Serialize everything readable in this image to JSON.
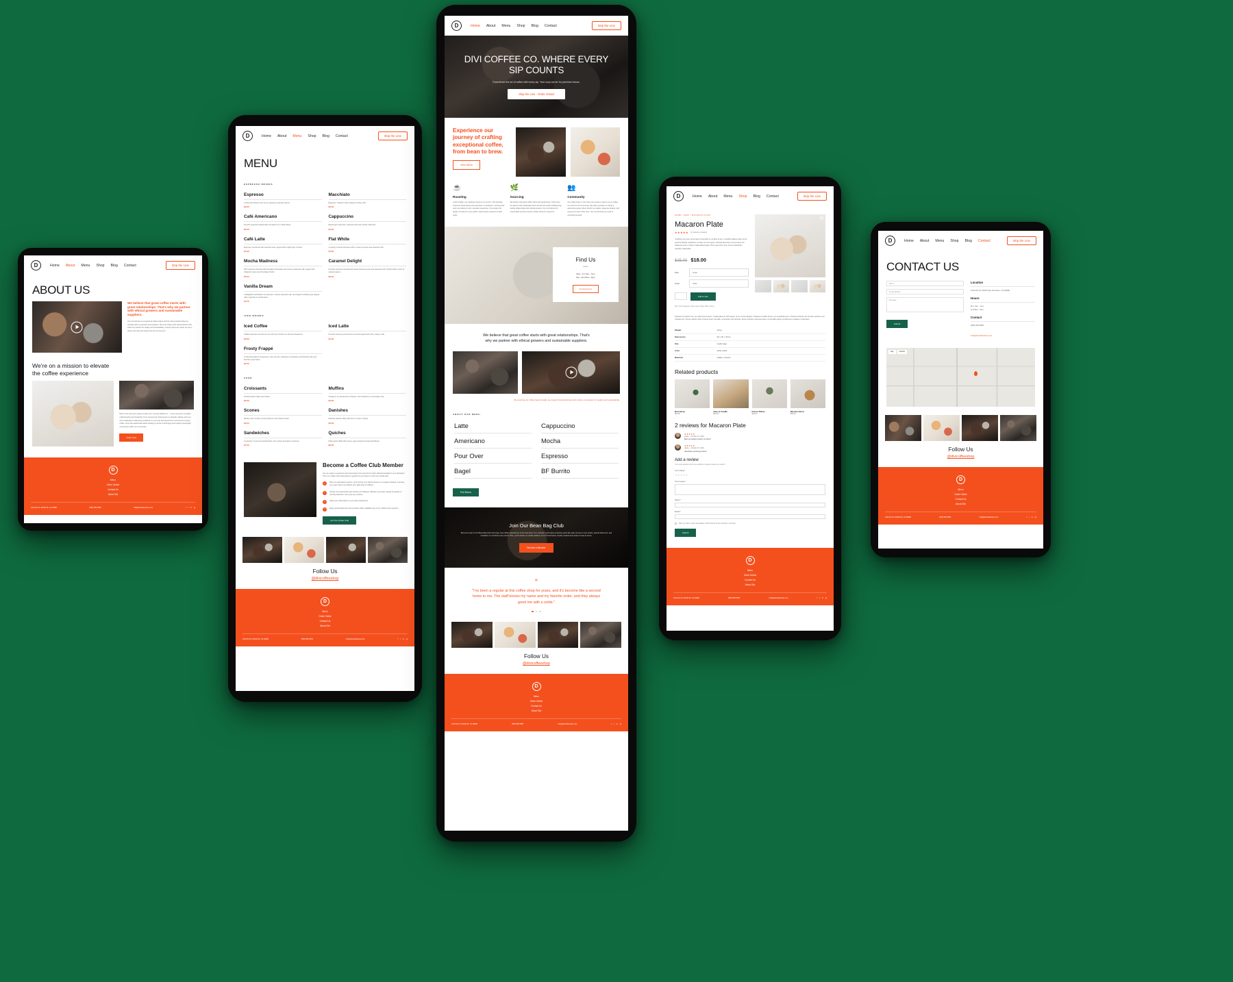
{
  "meta": {
    "background_color": "#0f6b3f",
    "accent": "#f4501e",
    "green": "#17614a"
  },
  "brand": {
    "logo_letter": "D",
    "handle": "@divicoffeeshop",
    "follow_title": "Follow Us"
  },
  "nav": {
    "items": [
      "Home",
      "About",
      "Menu",
      "Shop",
      "Blog",
      "Contact"
    ],
    "cta": "Skip the Line"
  },
  "footer": {
    "links": [
      "Menu",
      "Order Online",
      "Contact Us",
      "About Divi"
    ],
    "address": "1234 Divi St. #1000 SF, CA 94088",
    "phone": "(555) 555-5555",
    "email": "info@divicoffeeshop.com",
    "socials": [
      "f",
      "t",
      "in",
      "ig"
    ]
  },
  "devices": [
    {
      "id": "tablet-about",
      "page": "About Us"
    },
    {
      "id": "phone-menu",
      "page": "Menu"
    },
    {
      "id": "phone-home",
      "page": "Home"
    },
    {
      "id": "phone-product",
      "page": "Macaron Plate"
    },
    {
      "id": "phone-contact",
      "page": "Contact Us"
    }
  ],
  "about_page": {
    "title": "ABOUT US",
    "active_nav": "About",
    "lead": "We believe that great coffee starts with great relationships. That's why we partner with ethical growers and sustainable suppliers.",
    "lead_body": "Our commitment to exceptional coffee begins with the strong relationships we cultivate with our growers and suppliers. We work closely with ethical farmers who share our passion for quality and sustainability, ensuring that every bean we use is grown with care and respect for the environment.",
    "mission_heading": "We're on a mission to elevate the coffee experience",
    "mission_body": "We're more than just a place to grab your morning caffeine fix — we're purveyors of quality, craftsmanship and hospitality. From sourcing the finest beans to carefully crafting each cup, we're dedicated to delivering excellence in every sip. But beyond our commitment to great coffee, we're also passionate about fostering a sense of belonging and creating meaningful connections within our community.",
    "mission_cta": "Order Now"
  },
  "menu_page": {
    "title": "MENU",
    "active_nav": "Menu",
    "categories": [
      {
        "label": "ESPRESSO DRINKS",
        "left": [
          {
            "name": "Espresso",
            "desc": "A bold and intense shot of our signature espresso blend.",
            "price": "$3.00"
          },
          {
            "name": "Café Americano",
            "desc": "Smooth espresso diluted with hot water for a milder flavor.",
            "price": "$3.50"
          },
          {
            "name": "Café Latte",
            "desc": "Espresso combined with steamed milk, topped with a light layer of foam.",
            "price": "$4.50"
          },
          {
            "name": "Mocha Madness",
            "desc": "Rich espresso blended with decadent chocolate and creamy steamed milk, topped with whipped cream and chocolate drizzle.",
            "price": "$5.00"
          },
          {
            "name": "Vanilla Dream",
            "desc": "A delightful combination of espresso, velvety steamed milk, and fragrant vanilla syrup topped with a sprinkle of vanilla bean.",
            "price": "$4.75"
          }
        ],
        "right": [
          {
            "name": "Macchiato",
            "desc": "Espresso \"stained\" with a dollop of frothy milk.",
            "price": "$3.50"
          },
          {
            "name": "Cappuccino",
            "desc": "Equal parts espresso, steamed milk and velvety milk foam.",
            "price": "$4.00"
          },
          {
            "name": "Flat White",
            "desc": "A velvety smooth espresso with a creamy texture and steamed milk.",
            "price": "$4.50"
          },
          {
            "name": "Caramel Delight",
            "desc": "Smooth espresso infused with sweet caramel syrup and steamed milk, finished with a swirl of caramel sauce.",
            "price": "$5.00"
          }
        ]
      },
      {
        "label": "ICED DRINKS",
        "left": [
          {
            "name": "Iced Coffee",
            "desc": "Chilled espresso served over ice with your choice of milk and sweetener.",
            "price": "$3.50"
          },
          {
            "name": "Frosty Frappé",
            "desc": "A refreshing blend of espresso, milk, and ice, whipped to perfection and finished with your favorite syrup flavor.",
            "price": "$5.25"
          }
        ],
        "right": [
          {
            "name": "Iced Latte",
            "desc": "Smooth espresso poured over ice and topped with cold, creamy milk.",
            "price": "$4.25"
          }
        ]
      },
      {
        "label": "FOOD",
        "left": [
          {
            "name": "Croissants",
            "desc": "Freshly baked, flaky and buttery.",
            "price": "$3.00"
          },
          {
            "name": "Scones",
            "desc": "Buttery and crumbly, served with jam and clotted cream.",
            "price": "$3.25"
          },
          {
            "name": "Sandwiches",
            "desc": "A selection of gourmet sandwiches, from turkey avocado to caprese.",
            "price": "$7.50"
          }
        ],
        "right": [
          {
            "name": "Muffins",
            "desc": "Indulge in an assortment of flavors, from blueberry to chocolate chip.",
            "price": "$3.00"
          },
          {
            "name": "Danishes",
            "desc": "Delicate pastries filled with fruit or cream cheese.",
            "price": "$3.50"
          },
          {
            "name": "Quiches",
            "desc": "Flaky pastry filled with savory egg custard and assorted fillings.",
            "price": "$6.50"
          }
        ]
      }
    ],
    "club": {
      "title": "Become a Coffee Club Member",
      "intro": "Are you ready to experience the finest beans from around the world, delivered straight to your doorstep? Then our Coffee Club Subscription is perfect for you! Here's to how you should start:",
      "steps": [
        "Pick our subscription service, you'll receive your favorite beans on a regular schedule, ensuring you never have to go without your daily dose of caffeine.",
        "Choose the subscription plan that fits your lifestyle. Whether you prefer weekly, bi-weekly, or monthly deliveries, we've got you covered.",
        "Tailor your subscription to your taste preferences.",
        "Enjoy special discounts and exclusive offers available only to our Coffee Club members."
      ],
      "cta": "Join the Coffee Club"
    }
  },
  "home_page": {
    "active_nav": "Home",
    "hero_title": "DIVI COFFEE CO. WHERE EVERY SIP COUNTS",
    "hero_sub": "Experience the art of coffee with every sip. Your cozy corner for premium brews.",
    "hero_cta": "Skip the Line - Order Ahead",
    "intro_heading": "Experience our journey of crafting exceptional coffee, from bean to brew.",
    "intro_cta": "View Menu",
    "features": [
      {
        "icon": "☕",
        "title": "Roasting",
        "body": "At Divi Coffee, our roasting process is an art form. We carefully select the finest beans and roast them to perfection, ensuring that each cup delivers a rich, aromatic experience. Our passion for quality is evident in every batch, capturing the essence of each origin."
      },
      {
        "icon": "🌿",
        "title": "Sourcing",
        "body": "We believe that great coffee starts with great beans. That's why we partner with sustainable farms around the world, building long-lasting relationships with ethical growers. Our commitment to responsible sourcing means a better future for everyone."
      },
      {
        "icon": "👥",
        "title": "Community",
        "body": "Our coffee shop is more than just a place to grab a cup of coffee, it's a hub for the community. We pride ourselves on being a welcoming space where friends can gather, ideas are shared, and everyone is part of the story. Join us and become a part of something special."
      }
    ],
    "find_us": {
      "title": "Find Us",
      "subtitle": "Hours",
      "address_line1": "Mon - Fri   7am - 7pm",
      "address_line2": "Sat - Sun   8am - 5pm",
      "cta": "Get Directions"
    },
    "relationships_text": "We believe that great coffee starts with great relationships. That's why we partner with ethical growers and sustainable suppliers.",
    "sourcing_note": "By sourcing our coffee beans locally, we support trusted farmers who share our passion for quality and sustainability.",
    "about_tag": "ABOUT OUR MENU",
    "wordlist_left": [
      "Latte",
      "Americano",
      "Pour Over",
      "Bagel"
    ],
    "wordlist_right": [
      "Cappuccino",
      "Mocha",
      "Espresso",
      "BF Burrito"
    ],
    "wordlist_cta": "Full Menu",
    "band": {
      "title": "Join Our Bean Bag Club",
      "body": "Become a part of our Bean Bag Club and enjoy new coffee experiences to the next level. As a member you'll enjoy exclusive perks like early access to new roasts, special discounts, and invitations to members-only events. Plus, you'll receive a monthly delivery of our finest beans, freshly roasted and ready to brew at home.",
      "cta": "Become a Member"
    },
    "testimonial": {
      "text": "\"I've been a regular at this coffee shop for years, and it's become like a second home to me. The staff knows my name and my favorite order, and they always greet me with a smile.\""
    }
  },
  "product_page": {
    "active_nav": "Shop",
    "breadcrumb": "HOME / SHOP / MACARON PLATE",
    "title": "Macaron Plate",
    "rating_count": "(2 customer reviews)",
    "description": "Curabitur arcu erat, accumsan id imperdiet et, porttitor at sem. Curabitur aliquet quam id dui posuere blandit. Vestibulum ac diam sit amet quam vehicula elementum sed sit amet dui. Nulla quis lorem ut libero malesuada feugiat. Proin eget tortor risus. Donec sollicitudin molestie malesuada.",
    "price_old": "$25.00",
    "price_new": "$18.00",
    "attributes": [
      {
        "label": "Size",
        "value": "small"
      },
      {
        "label": "Color",
        "value": "white"
      }
    ],
    "qty": "1",
    "add_to_cart": "Add to cart",
    "sku_line": "SKU: N/A   Categories: Plate, Decor   Tags: Office, Decor",
    "long_desc": "Praesent id porttitor nisi, nec ullamcorper ipsum. Suspendisse at nibh sapien. Nunc viverra aliquam. Praesent ut tellus lectus, non imperdiet ipsum. Praesent lobortis nisl vel diam ultricies, sed volutpat sem. Donec efficitur dolor sit amet quam convallis, at hendrerit nisl vehicula. Donec interdum velit eget lacus, id convallis augue condimentum sodales in bibendum.",
    "specs": [
      {
        "k": "Weight",
        "v": "10 kg"
      },
      {
        "k": "Dimensions",
        "v": "30 × 20 × 40 cm"
      },
      {
        "k": "Size",
        "v": "small, large"
      },
      {
        "k": "Color",
        "v": "white, black"
      },
      {
        "k": "Materials",
        "v": "leather, ceramic"
      }
    ],
    "related_title": "Related products",
    "related": [
      {
        "name": "Bud Vases",
        "price": "$20.00"
      },
      {
        "name": "Vase & Candle",
        "price": "$35.00"
      },
      {
        "name": "Indoor Plants",
        "price": "$40.00"
      },
      {
        "name": "Wooden Stool",
        "price": "$55.00"
      }
    ],
    "reviews_title": "2 reviews for Macaron Plate",
    "reviews": [
      {
        "author": "arluke",
        "date": "October 15, 2022",
        "stars": "★★★★★",
        "text": "Best top quality product out there!"
      },
      {
        "author": "arluke",
        "date": "October 15, 2022",
        "stars": "★★★★★",
        "text": "Absolutely amazing product!"
      }
    ],
    "add_review_title": "Add a review",
    "add_review_note": "Your email address will not be published. Required fields are marked *",
    "rating_label": "Your rating *",
    "review_label": "Your review *",
    "name_label": "Name *",
    "email_label": "Email *",
    "save_label": "Save my name, email, and website in this browser for the next time I comment.",
    "submit": "Submit"
  },
  "contact_page": {
    "active_nav": "Contact",
    "title": "CONTACT US",
    "fields": [
      {
        "placeholder": "Name"
      },
      {
        "placeholder": "Email Address"
      },
      {
        "placeholder": "Message"
      }
    ],
    "submit": "Submit",
    "info": [
      {
        "title": "Location",
        "lines": [
          "1234 Divi St. #1000 San Francisco, CA 94088"
        ]
      },
      {
        "title": "Hours",
        "lines": [
          "M-F   7am - 7pm",
          "S-S   8am - 5pm"
        ]
      },
      {
        "title": "Contact",
        "lines": [
          "(555) 555-5555"
        ],
        "link": "info@divicoffeeshop.com"
      }
    ],
    "map_controls": [
      "Map",
      "Satellite"
    ]
  }
}
